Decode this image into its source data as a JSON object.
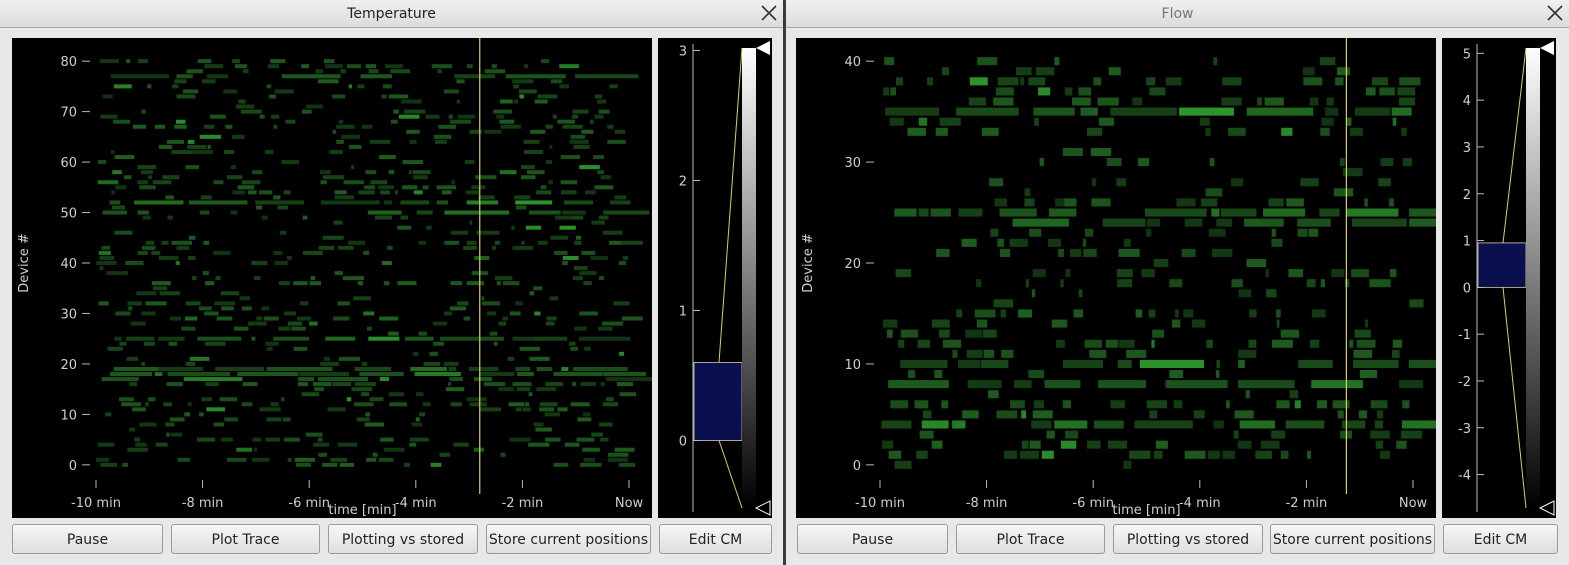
{
  "windows": [
    {
      "title": "Temperature",
      "chart_data": {
        "type": "heatmap",
        "xlabel": "time [min]",
        "ylabel": "Device #",
        "x_ticks": [
          "-10 min",
          "-8 min",
          "-6 min",
          "-4 min",
          "-2 min",
          "Now"
        ],
        "x_range_min": [
          -10,
          0
        ],
        "y_ticks": [
          "0",
          "10",
          "20",
          "30",
          "40",
          "50",
          "60",
          "70",
          "80"
        ],
        "ylim": [
          -3,
          83
        ],
        "device_count": 81,
        "cursor_time_min": -2.8,
        "colormap_scale": {
          "ticks": [
            "0",
            "1",
            "2",
            "3"
          ],
          "range": [
            -0.55,
            3.05
          ],
          "cm_low": 0,
          "cm_high": 3
        },
        "histogram_box": {
          "low": 0,
          "high": 0.6
        },
        "hot_rows": [
          17,
          18,
          19,
          25,
          50,
          52,
          77
        ]
      },
      "buttons": {
        "pause": "Pause",
        "plot_trace": "Plot Trace",
        "plotting": "Plotting vs stored",
        "store": "Store current positions",
        "edit_cm": "Edit CM"
      }
    },
    {
      "title": "Flow",
      "chart_data": {
        "type": "heatmap",
        "xlabel": "time [min]",
        "ylabel": "Device #",
        "x_ticks": [
          "-10 min",
          "-8 min",
          "-6 min",
          "-4 min",
          "-2 min",
          "Now"
        ],
        "x_range_min": [
          -10,
          0
        ],
        "y_ticks": [
          "0",
          "10",
          "20",
          "30",
          "40"
        ],
        "ylim": [
          -1.5,
          41.5
        ],
        "device_count": 41,
        "cursor_time_min": -1.25,
        "colormap_scale": {
          "ticks": [
            "-4",
            "-3",
            "-2",
            "-1",
            "0",
            "1",
            "2",
            "3",
            "4",
            "5"
          ],
          "range": [
            -4.8,
            5.2
          ],
          "cm_low": -4.5,
          "cm_high": 5
        },
        "histogram_box": {
          "low": 0,
          "high": 0.95
        },
        "hot_rows": [
          4,
          8,
          10,
          24,
          25,
          35
        ]
      },
      "buttons": {
        "pause": "Pause",
        "plot_trace": "Plot Trace",
        "plotting": "Plotting vs stored",
        "store": "Store current positions",
        "edit_cm": "Edit CM"
      }
    }
  ],
  "colors": {
    "background": "#000000",
    "cell": "#1f5c1f",
    "cell_bright": "#2f9a2f",
    "cursor": "#d8d060",
    "hist_box": "#0a0f50"
  }
}
